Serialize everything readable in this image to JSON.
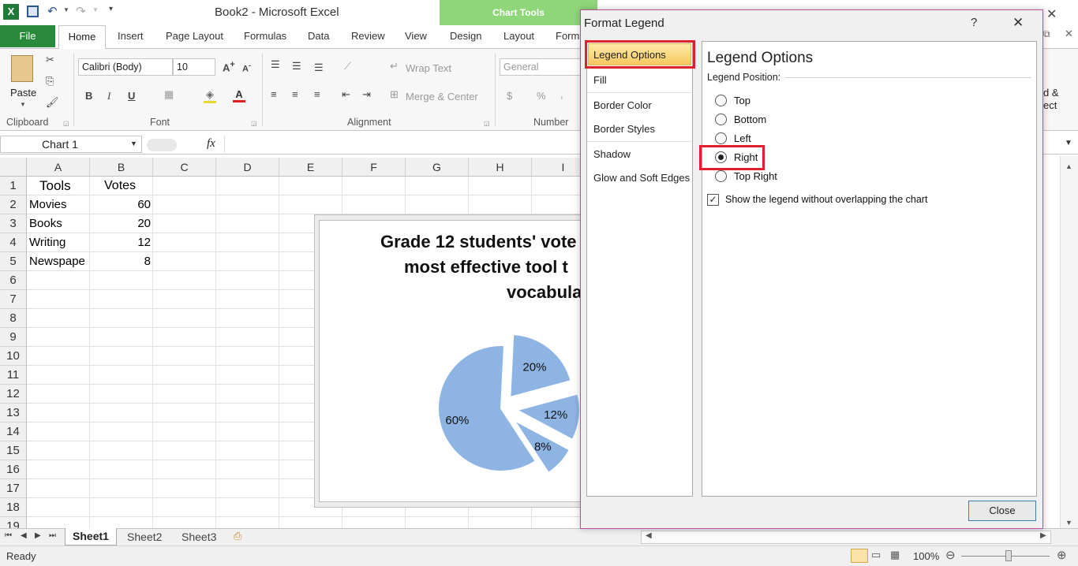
{
  "app": {
    "title": "Book2  -  Microsoft Excel",
    "chart_tools_label": "Chart Tools",
    "window_close_glyph": "✕"
  },
  "ribbon_tabs": [
    "File",
    "Home",
    "Insert",
    "Page Layout",
    "Formulas",
    "Data",
    "Review",
    "View",
    "Design",
    "Layout",
    "Form"
  ],
  "ribbon": {
    "paste_label": "Paste",
    "font_name": "Calibri (Body)",
    "font_size": "10",
    "wrap_text": "Wrap Text",
    "merge_center": "Merge & Center",
    "number_format": "General",
    "groups": {
      "clipboard": "Clipboard",
      "font": "Font",
      "alignment": "Alignment",
      "number": "Number"
    },
    "right_edge_text": "d &\nect"
  },
  "formula_bar": {
    "name_box": "Chart 1",
    "fx": "fx"
  },
  "sheet": {
    "columns": [
      "A",
      "B",
      "C",
      "D",
      "E",
      "F",
      "G",
      "H",
      "I"
    ],
    "rows": [
      "1",
      "2",
      "3",
      "4",
      "5",
      "6",
      "7",
      "8",
      "9",
      "10",
      "11",
      "12",
      "13",
      "14",
      "15",
      "16",
      "17",
      "18",
      "19"
    ],
    "cells": [
      [
        "Tools",
        "Votes"
      ],
      [
        "Movies",
        "60"
      ],
      [
        "Books",
        "20"
      ],
      [
        "Writing",
        "12"
      ],
      [
        "Newspape",
        "8"
      ]
    ]
  },
  "chart": {
    "title_line1": "Grade 12 students' vote",
    "title_line2": "most effective tool t",
    "title_line3": "vocabula",
    "slice_color": "#8eb4e3"
  },
  "chart_data": {
    "type": "pie",
    "title": "Grade 12 students' vote… most effective tool t… vocabula…",
    "categories": [
      "Movies",
      "Books",
      "Writing",
      "Newspape"
    ],
    "values": [
      60,
      20,
      12,
      8
    ],
    "data_labels": [
      "60%",
      "20%",
      "12%",
      "8%"
    ],
    "exploded": true
  },
  "sheet_tabs": [
    "Sheet1",
    "Sheet2",
    "Sheet3"
  ],
  "status": {
    "ready": "Ready",
    "zoom": "100%"
  },
  "dialog": {
    "title": "Format Legend",
    "help": "?",
    "close_x": "✕",
    "nav": [
      "Legend Options",
      "Fill",
      "Border Color",
      "Border Styles",
      "Shadow",
      "Glow and Soft Edges"
    ],
    "heading": "Legend Options",
    "position_label": "Legend Position:",
    "positions": [
      "Top",
      "Bottom",
      "Left",
      "Right",
      "Top Right"
    ],
    "selected_position": "Right",
    "checkbox_label": "Show the legend without overlapping the chart",
    "checkbox_checked": true,
    "close_button": "Close"
  }
}
